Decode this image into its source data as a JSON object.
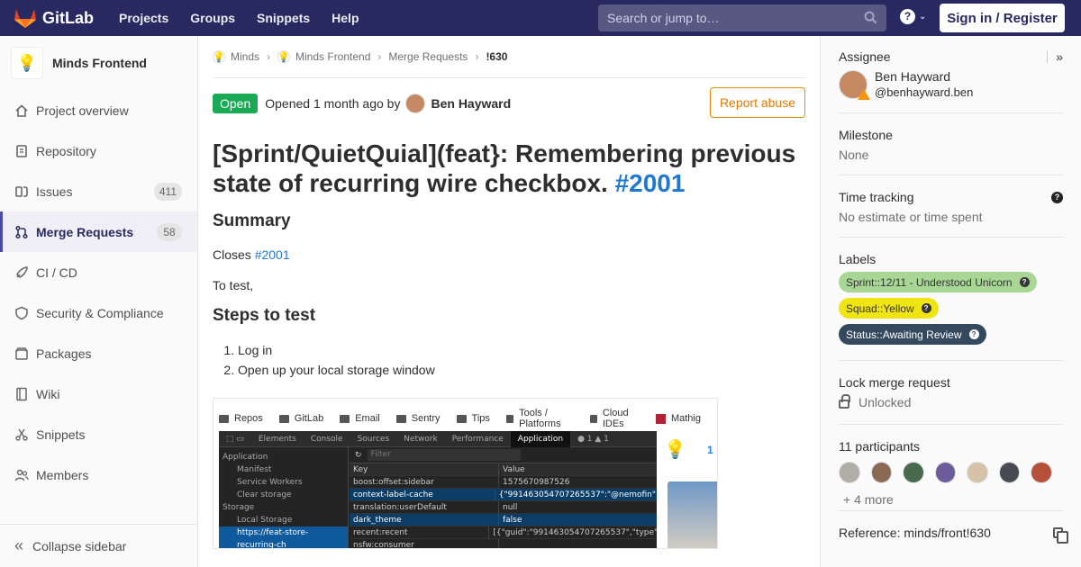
{
  "navbar": {
    "brand": "GitLab",
    "links": [
      "Projects",
      "Groups",
      "Snippets",
      "Help"
    ],
    "search_placeholder": "Search or jump to…",
    "signin": "Sign in / Register",
    "help_glyph": "?"
  },
  "sidebar": {
    "project_name": "Minds Frontend",
    "items": [
      {
        "label": "Project overview",
        "icon": "home-icon"
      },
      {
        "label": "Repository",
        "icon": "doc-icon"
      },
      {
        "label": "Issues",
        "icon": "issues-icon",
        "count": "411"
      },
      {
        "label": "Merge Requests",
        "icon": "merge-request-icon",
        "count": "58",
        "active": true
      },
      {
        "label": "CI / CD",
        "icon": "rocket-icon"
      },
      {
        "label": "Security & Compliance",
        "icon": "shield-icon"
      },
      {
        "label": "Packages",
        "icon": "package-icon"
      },
      {
        "label": "Wiki",
        "icon": "book-icon"
      },
      {
        "label": "Snippets",
        "icon": "scissors-icon"
      },
      {
        "label": "Members",
        "icon": "users-icon"
      }
    ],
    "collapse_label": "Collapse sidebar"
  },
  "breadcrumb": [
    "Minds",
    "Minds Frontend",
    "Merge Requests",
    "!630"
  ],
  "mr": {
    "status": "Open",
    "opened": "Opened 1 month ago by",
    "author": "Ben Hayward",
    "report": "Report abuse",
    "title": "[Sprint/QuietQuial](feat}: Remembering previous state of recurring wire checkbox.",
    "title_ref": "#2001",
    "summary_heading": "Summary",
    "closes_text": "Closes",
    "closes_ref": "#2001",
    "to_test": "To test,",
    "steps_heading": "Steps to test",
    "steps": [
      "Log in",
      "Open up your local storage window"
    ]
  },
  "screenshot": {
    "bookmarks": [
      "Repos",
      "GitLab",
      "Email",
      "Sentry",
      "Tips",
      "Tools / Platforms",
      "Cloud IDEs",
      "Mathig"
    ],
    "devtools_tabs": [
      "Elements",
      "Console",
      "Sources",
      "Network",
      "Performance",
      "Application"
    ],
    "errors": "● 1  ▲ 1",
    "left_panel": [
      "Application",
      "Manifest",
      "Service Workers",
      "Clear storage",
      "Storage",
      "Local Storage",
      "https://feat-store-recurring-ch"
    ],
    "filter_placeholder": "Filter",
    "columns": {
      "key": "Key",
      "value": "Value"
    },
    "rows": [
      {
        "k": "boost:offset:sidebar",
        "v": "1575670987526"
      },
      {
        "k": "context-label-cache",
        "v": "{\"991463054707265537\":\"@nemofin\"}"
      },
      {
        "k": "translation:userDefault",
        "v": "null"
      },
      {
        "k": "dark_theme",
        "v": "false"
      },
      {
        "k": "recent:recent",
        "v": "[{\"guid\":\"991463054707265537\",\"type\":..."
      },
      {
        "k": "nsfw:consumer",
        "v": ""
      }
    ],
    "app_blue": "1"
  },
  "right": {
    "assignee_label": "Assignee",
    "assignee_name": "Ben Hayward",
    "assignee_username": "@benhayward.ben",
    "milestone_label": "Milestone",
    "milestone_value": "None",
    "time_label": "Time tracking",
    "time_value": "No estimate or time spent",
    "labels_label": "Labels",
    "labels": [
      {
        "text": "Sprint::12/11 - Understood Unicorn",
        "bg": "#a8d695",
        "fg": "#333333"
      },
      {
        "text": "Squad::Yellow",
        "bg": "#f0e513",
        "fg": "#333333"
      },
      {
        "text": "Status::Awaiting Review",
        "bg": "#34495e",
        "fg": "#ffffff"
      }
    ],
    "lock_label": "Lock merge request",
    "lock_value": "Unlocked",
    "participants_label": "11 participants",
    "participant_colors": [
      "#b0aca6",
      "#8a6a55",
      "#4a6a4f",
      "#6d5c9a",
      "#d6c2a8",
      "#4a4a55",
      "#b5503a"
    ],
    "more": "+ 4 more",
    "reference": "Reference: minds/front!630"
  },
  "colors": {
    "nav": "#292961",
    "accent": "#1f78d1",
    "open": "#1aaa55",
    "report": "#e07a00"
  }
}
